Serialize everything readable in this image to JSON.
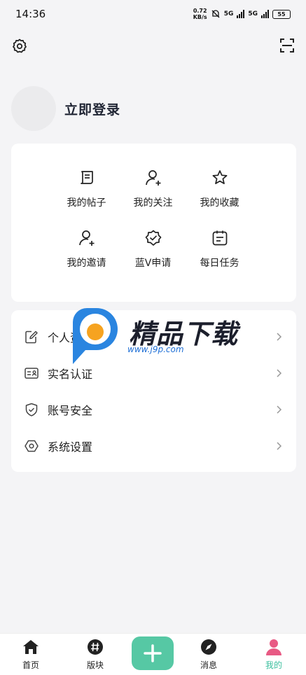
{
  "status_bar": {
    "time": "14:36",
    "net_speed_value": "0.72",
    "net_speed_unit": "KB/s",
    "signal1_label": "5G",
    "signal2_label": "5G",
    "battery": "55"
  },
  "profile": {
    "login_text": "立即登录"
  },
  "quick_actions": [
    {
      "label": "我的帖子",
      "icon": "posts-icon"
    },
    {
      "label": "我的关注",
      "icon": "follow-icon"
    },
    {
      "label": "我的收藏",
      "icon": "star-icon"
    },
    {
      "label": "我的邀请",
      "icon": "invite-icon"
    },
    {
      "label": "蓝V申请",
      "icon": "verified-badge-icon"
    },
    {
      "label": "每日任务",
      "icon": "task-icon"
    }
  ],
  "menu": [
    {
      "label": "个人资料",
      "icon": "edit-icon"
    },
    {
      "label": "实名认证",
      "icon": "id-card-icon"
    },
    {
      "label": "账号安全",
      "icon": "shield-icon"
    },
    {
      "label": "系统设置",
      "icon": "settings-hex-icon"
    }
  ],
  "watermark": {
    "title": "精品下载",
    "url": "www.j9p.com"
  },
  "bottom_nav": [
    {
      "label": "首页",
      "icon": "home-icon"
    },
    {
      "label": "版块",
      "icon": "hash-icon"
    },
    {
      "label": "",
      "icon": "plus-icon"
    },
    {
      "label": "消息",
      "icon": "compass-icon"
    },
    {
      "label": "我的",
      "icon": "user-icon"
    }
  ],
  "colors": {
    "accent": "#56c8a4",
    "active_tab_label": "#3cbf9e",
    "active_user_icon": "#e85a84",
    "background": "#f4f4f6"
  }
}
